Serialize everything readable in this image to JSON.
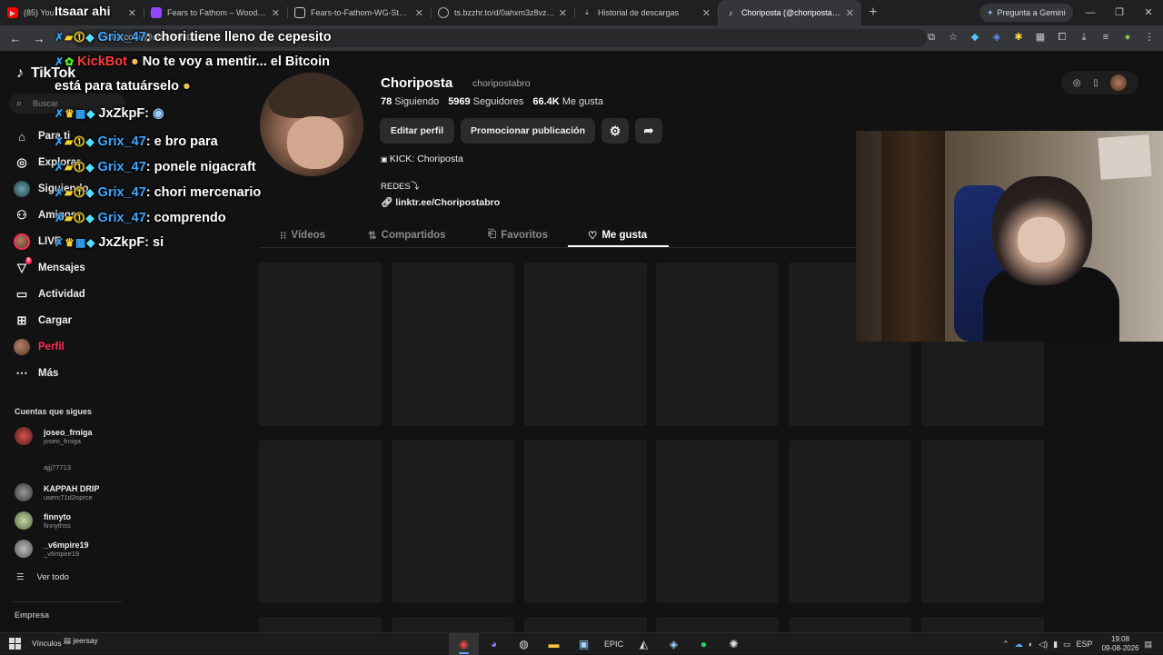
{
  "browser": {
    "tabs": [
      {
        "title": "(85) YouTube",
        "icon": "youtube-icon",
        "active": false
      },
      {
        "title": "Fears to Fathom – Woodbury G...",
        "icon": "twitch-icon",
        "active": false
      },
      {
        "title": "Fears-to-Fathom-WG-SteamRi...",
        "icon": "document-icon",
        "active": false
      },
      {
        "title": "ts.bzzhr.to/d/0ahxm3z8vz9r7v...",
        "icon": "globe-icon",
        "active": false
      },
      {
        "title": "Historial de descargas",
        "icon": "download-icon",
        "active": false
      },
      {
        "title": "Choriposta (@choripostabro) | ...",
        "icon": "tiktok-icon",
        "active": true
      }
    ],
    "gemini_label": "Pregunta a Gemini",
    "url": "tiktok.com/@choripostabro"
  },
  "tiktok": {
    "logo": "TikTok",
    "search_placeholder": "Buscar",
    "nav": [
      {
        "label": "Para ti",
        "icon": "home-icon"
      },
      {
        "label": "Explorar",
        "icon": "compass-icon"
      },
      {
        "label": "Siguiendo",
        "icon": "following-icon"
      },
      {
        "label": "Amigos",
        "icon": "friends-icon"
      },
      {
        "label": "LIVE",
        "icon": "live-icon"
      },
      {
        "label": "Mensajes",
        "icon": "messages-icon",
        "badge": "9"
      },
      {
        "label": "Actividad",
        "icon": "activity-icon"
      },
      {
        "label": "Cargar",
        "icon": "upload-icon"
      },
      {
        "label": "Perfil",
        "icon": "profile-avatar"
      },
      {
        "label": "Más",
        "icon": "more-icon"
      }
    ],
    "following_title": "Cuentas que sigues",
    "following": [
      {
        "name": "joseo_frniga",
        "handle": "joseo_frniga"
      },
      {
        "name": "",
        "handle": "ajjj77713"
      },
      {
        "name": "KAPPAH DRIP",
        "handle": "userc71d2oprce"
      },
      {
        "name": "finnyto",
        "handle": "finnythss"
      },
      {
        "name": "_v6mpire19",
        "handle": "_v6mpire19"
      }
    ],
    "see_all": "Ver todo",
    "company": "Empresa"
  },
  "profile": {
    "name": "Choriposta",
    "handle": "choripostabro",
    "following_count": "78",
    "following_label": "Siguiendo",
    "followers_count": "5969",
    "followers_label": "Seguidores",
    "likes_count": "66.4K",
    "likes_label": "Me gusta",
    "edit_button": "Editar perfil",
    "promote_button": "Promocionar publicación",
    "bio_line1": "KICK: Choriposta",
    "bio_line2": "REDES⤵",
    "link": "linktr.ee/Choripostabro",
    "tabs": [
      {
        "label": "Vídeos",
        "icon": "grid-icon"
      },
      {
        "label": "Compartidos",
        "icon": "repost-icon"
      },
      {
        "label": "Favoritos",
        "icon": "bookmark-icon"
      },
      {
        "label": "Me gusta",
        "icon": "heart-icon",
        "active": true
      }
    ]
  },
  "chat": {
    "title": "Itsaar ahi",
    "messages": [
      {
        "user": "Grix_47",
        "user_color": "#3ea6ff",
        "text": ": chori tiene lleno de cepesito"
      },
      {
        "user": "KickBot",
        "user_color": "#ff3b3b",
        "text": " No te voy a mentir... el Bitcoin"
      },
      {
        "user": "",
        "user_color": "#ffffff",
        "text": "está para tatuárselo"
      },
      {
        "user": "JxZkpF",
        "user_color": "#ffffff",
        "text": ":"
      },
      {
        "user": "Grix_47",
        "user_color": "#3ea6ff",
        "text": ": e bro para"
      },
      {
        "user": "Grix_47",
        "user_color": "#3ea6ff",
        "text": ": ponele nigacraft"
      },
      {
        "user": "Grix_47",
        "user_color": "#3ea6ff",
        "text": ": chori mercenario"
      },
      {
        "user": "Grix_47",
        "user_color": "#3ea6ff",
        "text": ": comprendo"
      },
      {
        "user": "JxZkpF",
        "user_color": "#ffffff",
        "text": ": si"
      }
    ]
  },
  "taskbar": {
    "links_label": "Vínculos",
    "user_label": "jeersay",
    "lang": "ESP",
    "time": "19:08",
    "date": "09-08-2026"
  },
  "colors": {
    "accent": "#fe2c55",
    "background": "#121212",
    "chat_blue": "#3ea6ff"
  }
}
